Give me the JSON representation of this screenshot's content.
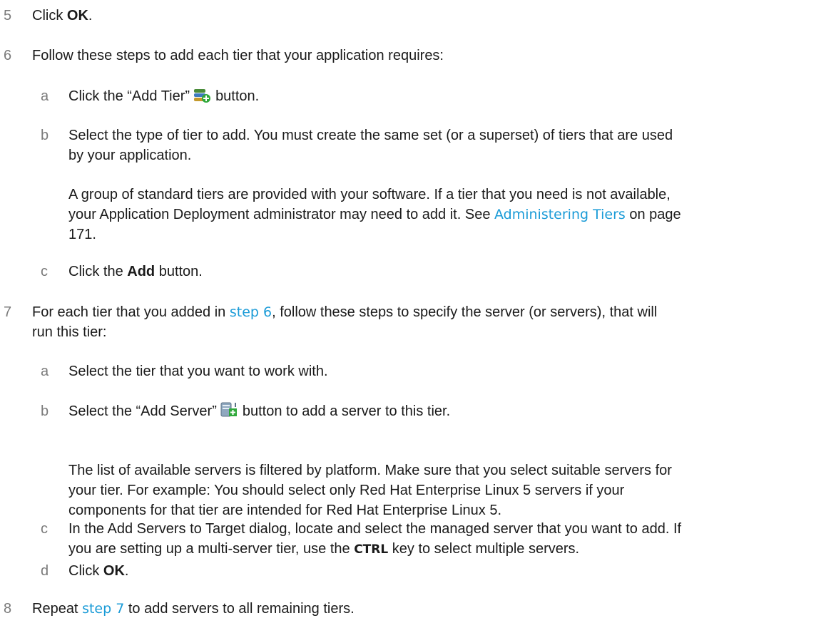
{
  "steps": {
    "s5": {
      "number": "5",
      "click": "Click ",
      "ok": "OK",
      "period": "."
    },
    "s6": {
      "number": "6",
      "text": "Follow these steps to add each tier that your application requires:",
      "a": {
        "letter": "a",
        "before": "Click the “Add Tier”",
        "after": "button.",
        "icon": "add-tier-icon"
      },
      "b": {
        "letter": "b",
        "line1": "Select the type of tier to add. You must create the same set (or a superset) of tiers that are used",
        "line2": "by your application.",
        "note_line1": "A group of standard tiers are provided with your software. If a tier that you need is not available,",
        "note_line2_before": "your Application Deployment administrator may need to add it. See ",
        "note_link": "Administering Tiers",
        "note_line2_after": " on page",
        "note_line3": "171."
      },
      "c": {
        "letter": "c",
        "before": "Click the ",
        "bold": "Add",
        "after": " button."
      }
    },
    "s7": {
      "number": "7",
      "before": "For each tier that you added in ",
      "link": "step 6",
      "after": ", follow these steps to specify the server (or servers), that will",
      "line2": "run this tier:",
      "a": {
        "letter": "a",
        "text": "Select the tier that you want to work with."
      },
      "b": {
        "letter": "b",
        "before": "Select the “Add Server”",
        "after": "button to add a server to this tier.",
        "icon": "add-server-icon",
        "note_line1": "The list of available servers is filtered by platform. Make sure that you select suitable servers for",
        "note_line2": "your tier. For example: You should select only Red Hat Enterprise Linux 5 servers if your",
        "note_line3": "components for that tier are intended for Red Hat Enterprise Linux 5."
      },
      "c": {
        "letter": "c",
        "line1": "In the Add Servers to Target dialog, locate and select the managed server that you want to add. If",
        "line2_before": "you are setting up a multi-server tier, use the ",
        "line2_bold": "CTRL",
        "line2_after": " key to select multiple servers."
      },
      "d": {
        "letter": "d",
        "click": "Click ",
        "ok": "OK",
        "period": "."
      }
    },
    "s8": {
      "number": "8",
      "before": "Repeat ",
      "link": "step 7",
      "after": " to add servers to all remaining tiers."
    }
  },
  "colors": {
    "link": "#1a9bd7",
    "number": "#7a7a7a",
    "text": "#1a1a1a"
  }
}
